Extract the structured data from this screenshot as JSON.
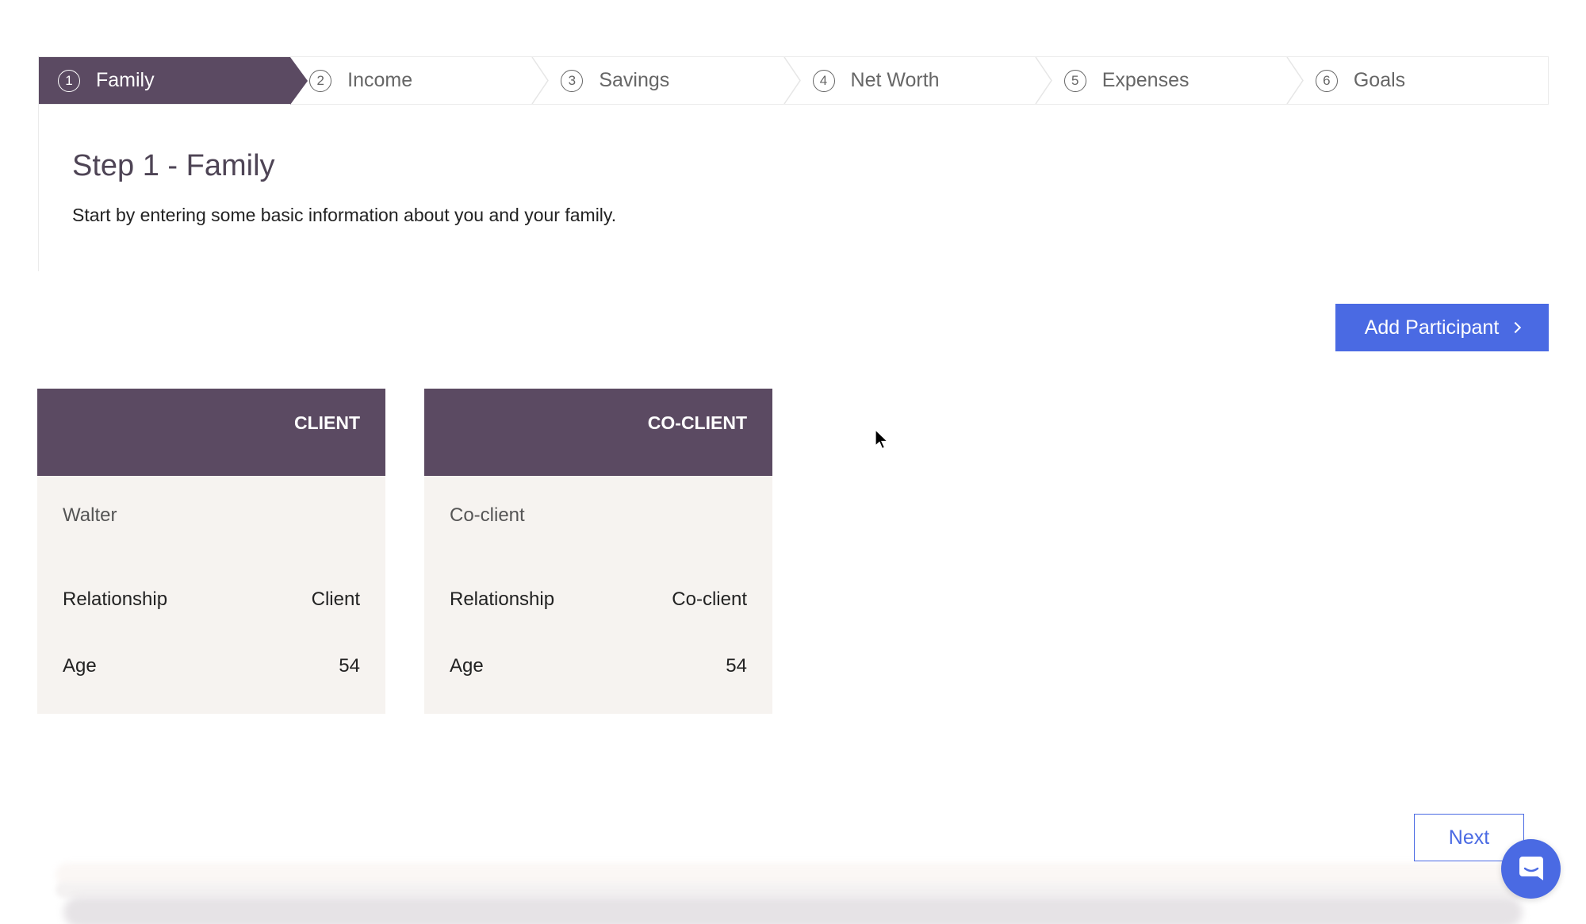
{
  "stepper": {
    "steps": [
      {
        "num": "1",
        "label": "Family",
        "active": true
      },
      {
        "num": "2",
        "label": "Income",
        "active": false
      },
      {
        "num": "3",
        "label": "Savings",
        "active": false
      },
      {
        "num": "4",
        "label": "Net Worth",
        "active": false
      },
      {
        "num": "5",
        "label": "Expenses",
        "active": false
      },
      {
        "num": "6",
        "label": "Goals",
        "active": false
      }
    ]
  },
  "header": {
    "title": "Step 1 - Family",
    "subtitle": "Start by entering some basic information about you and your family."
  },
  "actions": {
    "add_participant_label": "Add Participant",
    "next_label": "Next"
  },
  "participants": [
    {
      "role": "CLIENT",
      "name": "Walter",
      "relationship_label": "Relationship",
      "relationship_value": "Client",
      "age_label": "Age",
      "age_value": "54"
    },
    {
      "role": "CO-CLIENT",
      "name": "Co-client",
      "relationship_label": "Relationship",
      "relationship_value": "Co-client",
      "age_label": "Age",
      "age_value": "54"
    }
  ],
  "icons": {
    "step_number": "circled-number-icon",
    "add_participant": "chevron-right-icon",
    "chat": "chat-bubble-icon",
    "cursor": "mouse-pointer-icon"
  },
  "colors": {
    "brand_purple": "#5b4a62",
    "accent_blue": "#4a6ae3",
    "card_bg": "#f6f3f0"
  }
}
